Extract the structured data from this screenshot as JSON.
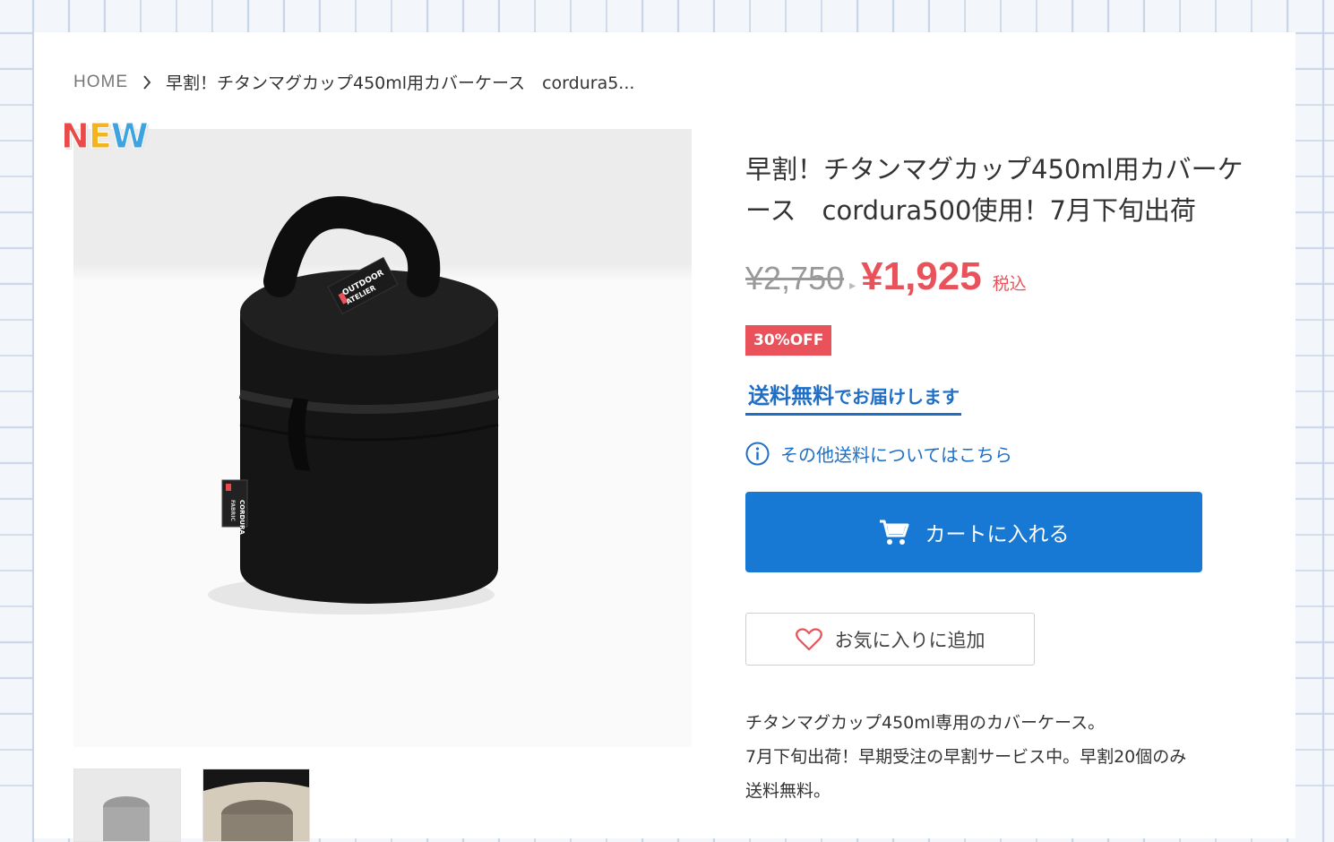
{
  "breadcrumb": {
    "home": "HOME",
    "current": "早割！チタンマグカップ450ml用カバーケース　cordura5..."
  },
  "badge": {
    "new_letters": [
      "N",
      "E",
      "W"
    ]
  },
  "product": {
    "title": "早割！チタンマグカップ450ml用カバーケース　cordura500使用！7月下旬出荷",
    "old_price": "¥2,750",
    "price": "¥1,925",
    "tax_label": "税込",
    "discount": "30%OFF",
    "free_shipping": "送料無料",
    "free_shipping_suffix": "でお届けします",
    "other_shipping_link": "その他送料についてはこちら",
    "cart_button": "カートに入れる",
    "favorite_button": "お気に入りに追加",
    "description": [
      "チタンマグカップ450ml専用のカバーケース。",
      "7月下旬出荷！早期受注の早割サービス中。早割20個のみ",
      "送料無料。"
    ],
    "image_labels": {
      "handle_tag_line1": "OUTDOOR",
      "handle_tag_line2": "ATELIER",
      "fabric_tag_brand": "CORDURA",
      "fabric_tag_sub": "FABRIC"
    }
  },
  "colors": {
    "accent_blue": "#1779d4",
    "link_blue": "#1f6fc7",
    "sale_red": "#e9525a"
  },
  "icons": {
    "breadcrumb_separator": "chevron-right-icon",
    "info": "info-icon",
    "cart": "cart-icon",
    "favorite": "heart-icon"
  }
}
